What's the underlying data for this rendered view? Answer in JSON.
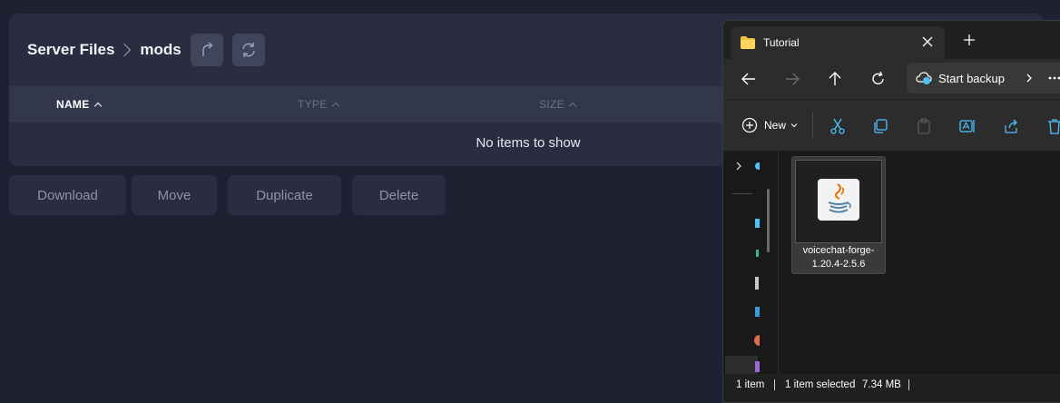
{
  "server_files": {
    "breadcrumb": [
      "Server Files",
      "mods"
    ],
    "toolbar": {
      "up_icon": "up-folder-icon",
      "refresh_icon": "refresh-icon"
    },
    "columns": [
      {
        "label": "NAME",
        "sort": "asc",
        "active": true
      },
      {
        "label": "TYPE",
        "sort": "asc",
        "active": false
      },
      {
        "label": "SIZE",
        "sort": "asc",
        "active": false
      }
    ],
    "empty_message": "No items to show",
    "actions": [
      "Download",
      "Move",
      "Duplicate",
      "Delete"
    ]
  },
  "explorer": {
    "tab_title": "Tutorial",
    "address_button": "Start backup",
    "new_button": "New",
    "files": [
      {
        "name_line1": "voicechat-forge-",
        "name_line2": "1.20.4-2.5.6",
        "icon": "java-jar-icon",
        "selected": true
      }
    ],
    "status": {
      "count": "1 item",
      "selected": "1 item selected",
      "size": "7.34 MB"
    }
  },
  "colors": {
    "page_bg": "#1f2132",
    "panel_bg": "#2a2d40",
    "header_bg": "#33374c",
    "explorer_bg": "#191919"
  }
}
